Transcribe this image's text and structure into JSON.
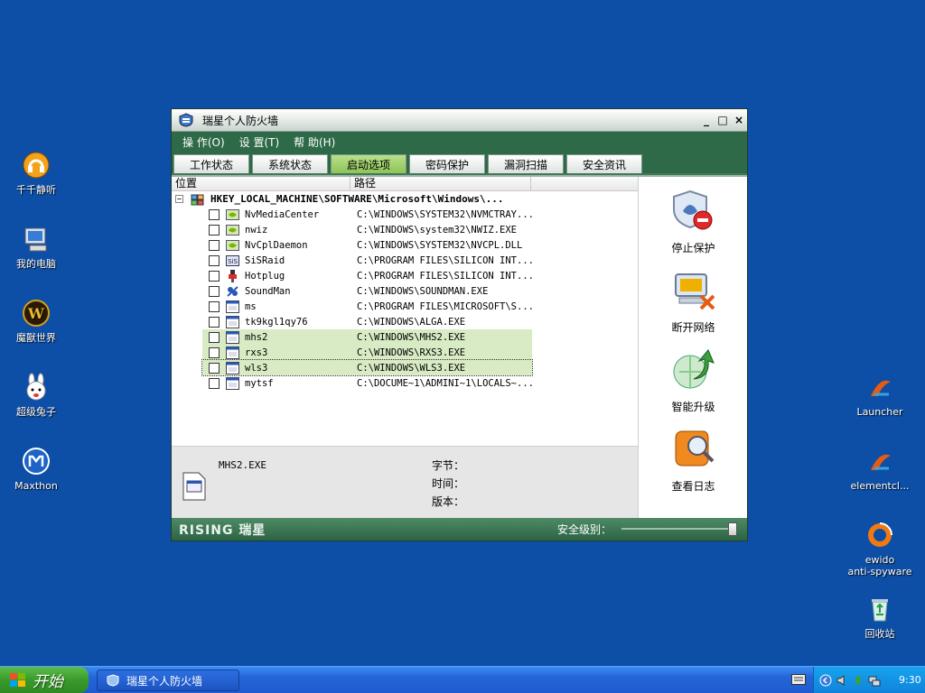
{
  "desktop": {
    "left_icons": [
      {
        "label": "千千静听"
      },
      {
        "label": "我的电脑"
      },
      {
        "label": "魔獸世界"
      },
      {
        "label": "超级兔子"
      },
      {
        "label": "Maxthon"
      }
    ],
    "right_icons": [
      {
        "label": "Launcher"
      },
      {
        "label": "elementcl..."
      },
      {
        "label": "ewido\nanti-spyware"
      },
      {
        "label": "回收站"
      }
    ]
  },
  "window": {
    "title": "瑞星个人防火墙",
    "controls": {
      "minimize": "_",
      "maximize": "□",
      "close": "×"
    },
    "menu": [
      "操 作(O)",
      "设 置(T)",
      "帮 助(H)"
    ],
    "tabs": [
      {
        "label": "工作状态",
        "active": false
      },
      {
        "label": "系统状态",
        "active": false
      },
      {
        "label": "启动选项",
        "active": true
      },
      {
        "label": "密码保护",
        "active": false
      },
      {
        "label": "漏洞扫描",
        "active": false
      },
      {
        "label": "安全资讯",
        "active": false
      }
    ],
    "columns": {
      "location": "位置",
      "path": "路径"
    },
    "root_key": "HKEY_LOCAL_MACHINE\\SOFTWARE\\Microsoft\\Windows\\...",
    "tree_toggle": "−",
    "rows": [
      {
        "name": "NvMediaCenter",
        "path": "C:\\WINDOWS\\SYSTEM32\\NVMCTRAY...",
        "icon": "nvidia-icon",
        "state": "normal"
      },
      {
        "name": "nwiz",
        "path": "C:\\WINDOWS\\system32\\NWIZ.EXE",
        "icon": "nvidia-icon",
        "state": "normal"
      },
      {
        "name": "NvCplDaemon",
        "path": "C:\\WINDOWS\\SYSTEM32\\NVCPL.DLL",
        "icon": "nvidia-icon",
        "state": "normal"
      },
      {
        "name": "SiSRaid",
        "path": "C:\\PROGRAM FILES\\SILICON INT...",
        "icon": "sis-icon",
        "state": "normal"
      },
      {
        "name": "Hotplug",
        "path": "C:\\PROGRAM FILES\\SILICON INT...",
        "icon": "plug-icon",
        "state": "normal"
      },
      {
        "name": "SoundMan",
        "path": "C:\\WINDOWS\\SOUNDMAN.EXE",
        "icon": "sound-icon",
        "state": "normal"
      },
      {
        "name": "ms",
        "path": "C:\\PROGRAM FILES\\MICROSOFT\\S...",
        "icon": "exe-icon",
        "state": "normal"
      },
      {
        "name": "tk9kgl1qy76",
        "path": "C:\\WINDOWS\\ALGA.EXE",
        "icon": "exe-icon",
        "state": "normal"
      },
      {
        "name": "mhs2",
        "path": "C:\\WINDOWS\\MHS2.EXE",
        "icon": "exe-icon",
        "state": "hl"
      },
      {
        "name": "rxs3",
        "path": "C:\\WINDOWS\\RXS3.EXE",
        "icon": "exe-icon",
        "state": "hl"
      },
      {
        "name": "wls3",
        "path": "C:\\WINDOWS\\WLS3.EXE",
        "icon": "exe-icon",
        "state": "sel"
      },
      {
        "name": "mytsf",
        "path": "C:\\DOCUME~1\\ADMINI~1\\LOCALS~...",
        "icon": "exe-icon",
        "state": "normal"
      }
    ],
    "details": {
      "file_name": "MHS2.EXE",
      "size_label": "字节：",
      "time_label": "时间：",
      "version_label": "版本："
    },
    "sidebar": [
      {
        "label": "停止保护",
        "icon": "stop-protection-icon"
      },
      {
        "label": "断开网络",
        "icon": "disconnect-network-icon"
      },
      {
        "label": "智能升级",
        "icon": "smart-upgrade-icon"
      },
      {
        "label": "查看日志",
        "icon": "view-log-icon"
      }
    ],
    "status": {
      "brand": "RISING 瑞星",
      "level_label": "安全级别："
    }
  },
  "taskbar": {
    "start_label": "开始",
    "task": "瑞星个人防火墙",
    "clock": "9:30"
  },
  "colors": {
    "desktop": "#0d4ea6",
    "window_frame": "#3f7a57",
    "active_tab": "#8dc457",
    "row_highlight": "#d8ebc4"
  }
}
